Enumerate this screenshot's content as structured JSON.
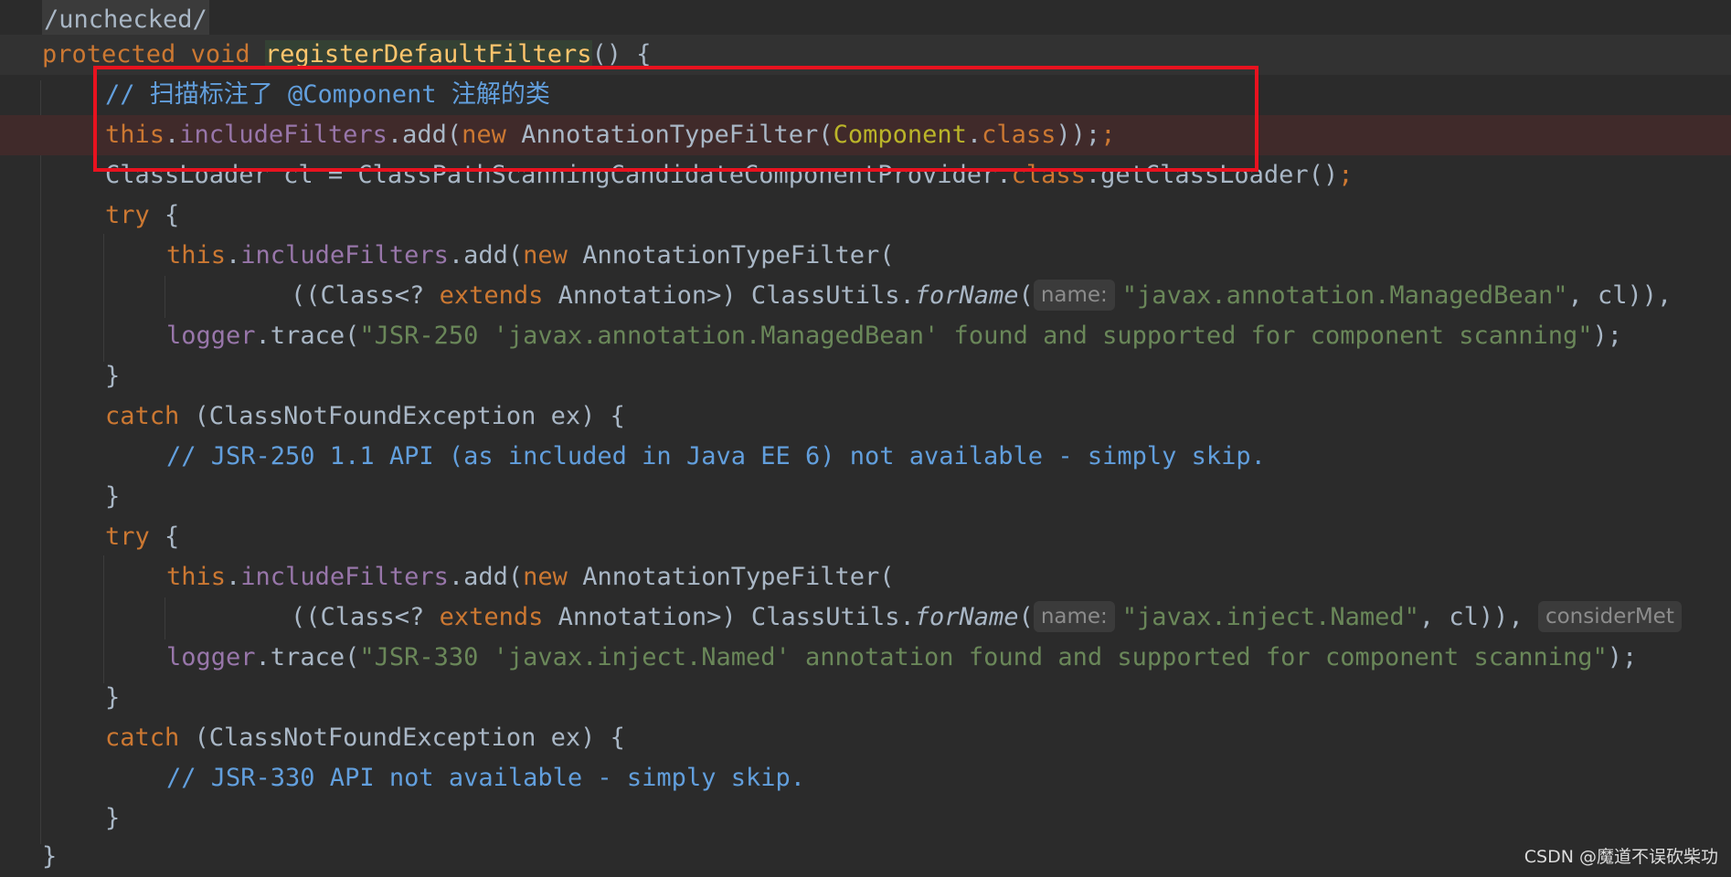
{
  "editor": {
    "lines": [
      {
        "t": "/unchecked/"
      },
      {
        "t1": "protected",
        "t2": "void",
        "t3": "registerDefaultFilters",
        "t4": "() {"
      },
      {
        "t1": "// 扫描标注了 @Component 注解的类"
      },
      {
        "t1": "this",
        "t2": ".",
        "t3": "includeFilters",
        "t4": ".add(",
        "t5": "new",
        "t6": " AnnotationTypeFilter(",
        "t7": "Component",
        "t8": ".",
        "t9": "class",
        "t10": "));"
      },
      {
        "t1": "ClassLoader cl = ClassPathScanningCandidateComponentProvider.",
        "t2": "class",
        "t3": ".getClassLoader()",
        "t4": ";"
      },
      {
        "t1": "try",
        "t2": " {"
      },
      {
        "t1": "this",
        "t2": ".",
        "t3": "includeFilters",
        "t4": ".add(",
        "t5": "new",
        "t6": " AnnotationTypeFilter("
      },
      {
        "t1": "((Class<? ",
        "t2": "extends",
        "t3": " Annotation>) ClassUtils.",
        "t4": "forName",
        "t5": "(",
        "t6": "name:",
        "t7": "\"javax.annotation.ManagedBean\"",
        "t8": ", cl)),"
      },
      {
        "t1": "logger",
        "t2": ".trace(",
        "t3": "\"JSR-250 'javax.annotation.ManagedBean' found and supported for component scanning\"",
        "t4": ");"
      },
      {
        "t1": "}"
      },
      {
        "t1": "catch",
        "t2": " (ClassNotFoundException ex) {"
      },
      {
        "t1": "// JSR-250 1.1 API (as included in Java EE 6) not available - simply skip."
      },
      {
        "t1": "}"
      },
      {
        "t1": "try",
        "t2": " {"
      },
      {
        "t1": "this",
        "t2": ".",
        "t3": "includeFilters",
        "t4": ".add(",
        "t5": "new",
        "t6": " AnnotationTypeFilter("
      },
      {
        "t1": "((Class<? ",
        "t2": "extends",
        "t3": " Annotation>) ClassUtils.",
        "t4": "forName",
        "t5": "(",
        "t6": "name:",
        "t7": "\"javax.inject.Named\"",
        "t8": ", cl)),",
        "t9": "considerMet"
      },
      {
        "t1": "logger",
        "t2": ".trace(",
        "t3": "\"JSR-330 'javax.inject.Named' annotation found and supported for component scanning\"",
        "t4": ");"
      },
      {
        "t1": "}"
      },
      {
        "t1": "catch",
        "t2": " (ClassNotFoundException ex) {"
      },
      {
        "t1": "// JSR-330 API not available - simply skip."
      },
      {
        "t1": "}"
      },
      {
        "t1": "}"
      }
    ]
  },
  "annotation_box": {
    "color": "#e8121f"
  },
  "watermark": "CSDN @魔道不误砍柴功",
  "colors": {
    "background": "#2b2b2b",
    "keyword": "#cc7832",
    "field": "#9876aa",
    "string": "#6a8759",
    "comment": "#629fdd",
    "annotation": "#bbb529"
  }
}
